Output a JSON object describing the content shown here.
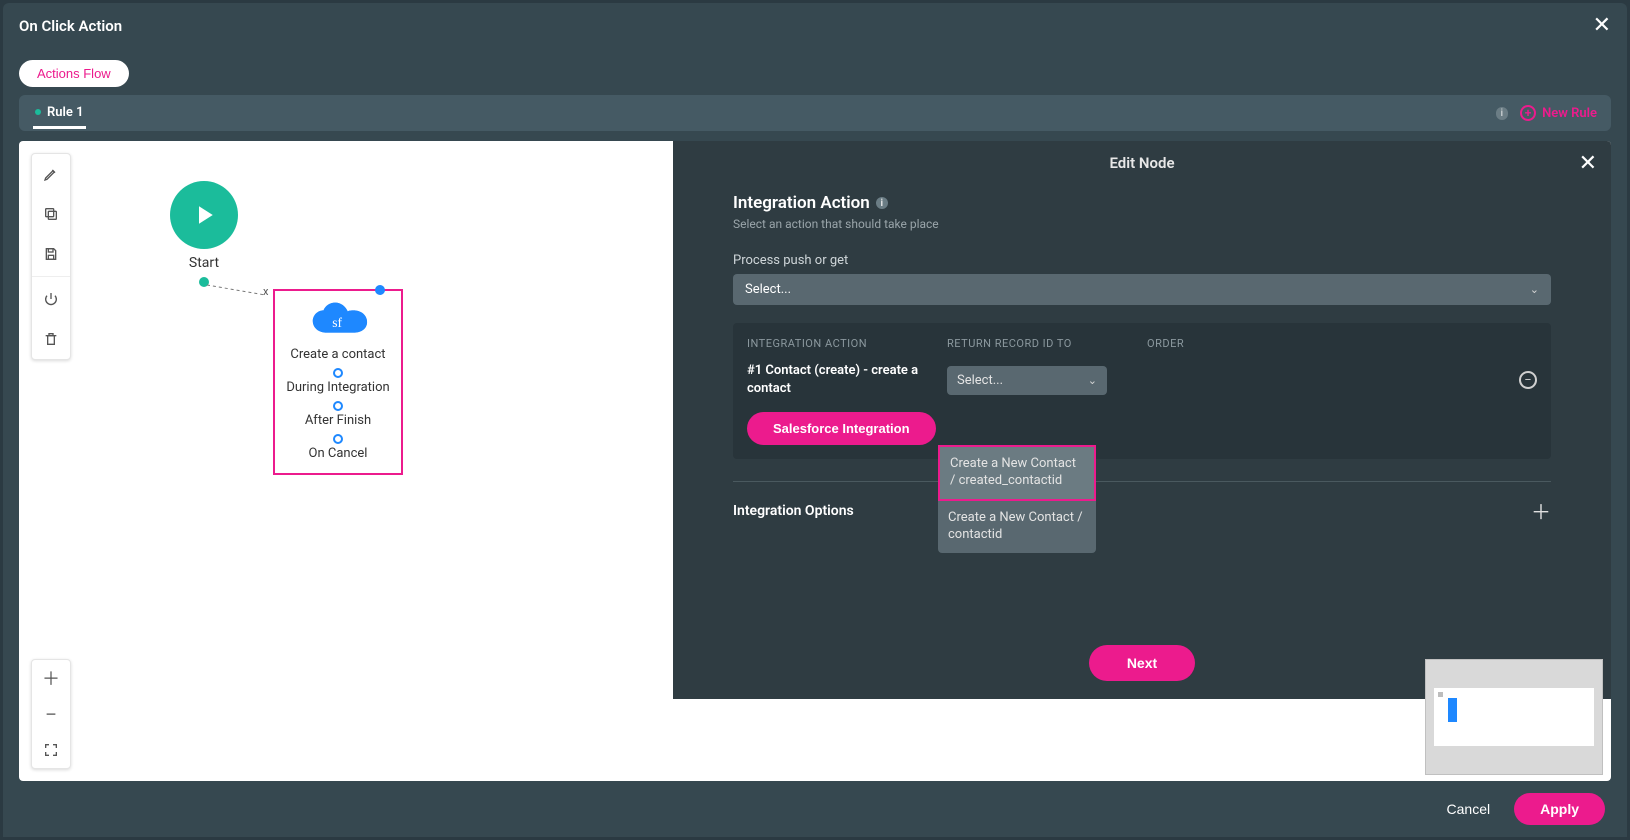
{
  "modal": {
    "title": "On Click Action",
    "actions_flow_label": "Actions Flow",
    "rule_tab": "Rule 1",
    "new_rule_label": "New Rule"
  },
  "flow": {
    "start_label": "Start",
    "sf_node": {
      "title": "Create a contact",
      "stage1": "During Integration",
      "stage2": "After Finish",
      "stage3": "On Cancel"
    }
  },
  "edit": {
    "header": "Edit Node",
    "section_title": "Integration Action",
    "section_sub": "Select an action that should take place",
    "process_label": "Process push or get",
    "process_select_placeholder": "Select...",
    "cols": {
      "c1": "INTEGRATION ACTION",
      "c2": "RETURN RECORD ID TO",
      "c3": "ORDER"
    },
    "row1_name": "#1 Contact (create) - create a contact",
    "row1_select_placeholder": "Select...",
    "sf_integration_btn": "Salesforce Integration",
    "options_label": "Integration Options",
    "next_btn": "Next"
  },
  "dropdown": {
    "opt1": "Create a New Contact / created_contactid",
    "opt2": "Create a New Contact / contactid"
  },
  "footer": {
    "cancel": "Cancel",
    "apply": "Apply"
  }
}
